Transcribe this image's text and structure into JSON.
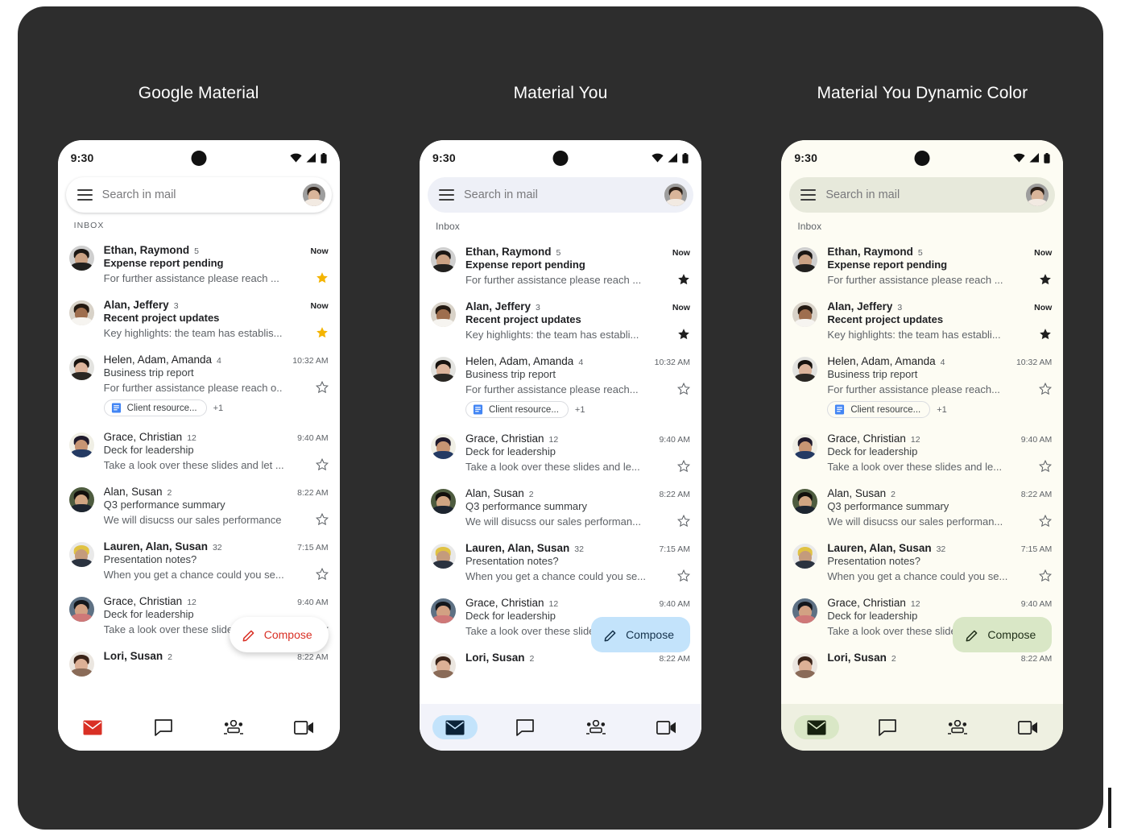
{
  "titles": [
    "Google Material",
    "Material You",
    "Material You Dynamic Color"
  ],
  "status_bar": {
    "time": "9:30"
  },
  "search": {
    "placeholder": "Search in mail"
  },
  "inbox_labels": [
    "INBOX",
    "Inbox",
    "Inbox"
  ],
  "compose": {
    "label": "Compose"
  },
  "nav": {
    "items": [
      "mail-icon",
      "chat-icon",
      "spaces-icon",
      "meet-icon"
    ],
    "active_index": 0
  },
  "colors": {
    "page_background": "#ffffff",
    "panel_background": "#2d2d2d",
    "classic_accent": "#d93025",
    "you_accent": "#c3e3fb",
    "dynamic_accent": "#d9e7c6",
    "classic_star": "#f4b400",
    "doc_blue": "#4285f4",
    "title_text": "#ffffff"
  },
  "emails": [
    {
      "sender": "Ethan, Raymond",
      "count": "5",
      "time": "Now",
      "subject": "Expense report pending",
      "snippet_classic": "For further assistance please reach ...",
      "snippet": "For further assistance please reach ...",
      "unread": true,
      "starred": true,
      "chip": null
    },
    {
      "sender": "Alan, Jeffery",
      "count": "3",
      "time": "Now",
      "subject": "Recent project updates",
      "snippet_classic": "Key highlights: the team has establis...",
      "snippet": "Key highlights: the team has establi...",
      "unread": true,
      "starred": true,
      "chip": null
    },
    {
      "sender": "Helen, Adam, Amanda",
      "count": "4",
      "time": "10:32 AM",
      "subject": "Business trip report",
      "snippet_classic": "For further assistance please reach o..",
      "snippet": "For further assistance please reach...",
      "unread": false,
      "starred": false,
      "chip": {
        "label": "Client resource...",
        "more": "+1",
        "icon": "google-docs-icon"
      }
    },
    {
      "sender": "Grace, Christian",
      "count": "12",
      "time": "9:40 AM",
      "subject": "Deck for leadership",
      "snippet_classic": "Take a look over these slides and let ...",
      "snippet": "Take a look over these slides and le...",
      "unread": false,
      "starred": false,
      "chip": null
    },
    {
      "sender": "Alan, Susan",
      "count": "2",
      "time": "8:22 AM",
      "subject": "Q3 performance summary",
      "snippet_classic": "We will disucss our sales performance",
      "snippet": "We will disucss our sales performan...",
      "unread": false,
      "starred": false,
      "chip": null
    },
    {
      "sender": "Lauren, Alan, Susan",
      "count": "32",
      "time": "7:15 AM",
      "subject": "Presentation notes?",
      "snippet_classic": "When you get a chance could you se...",
      "snippet": "When you get a chance could you se...",
      "unread": true,
      "starred": false,
      "chip": null
    },
    {
      "sender": "Grace, Christian",
      "count": "12",
      "time": "9:40 AM",
      "subject": "Deck for leadership",
      "snippet_classic": "Take a look over these slides",
      "snippet": "Take a look over these slides",
      "unread": false,
      "starred": false,
      "chip": null
    },
    {
      "sender": "Lori, Susan",
      "count": "2",
      "time": "8:22 AM",
      "subject": "",
      "snippet_classic": "",
      "snippet": "",
      "unread": true,
      "starred": false,
      "chip": null
    }
  ]
}
